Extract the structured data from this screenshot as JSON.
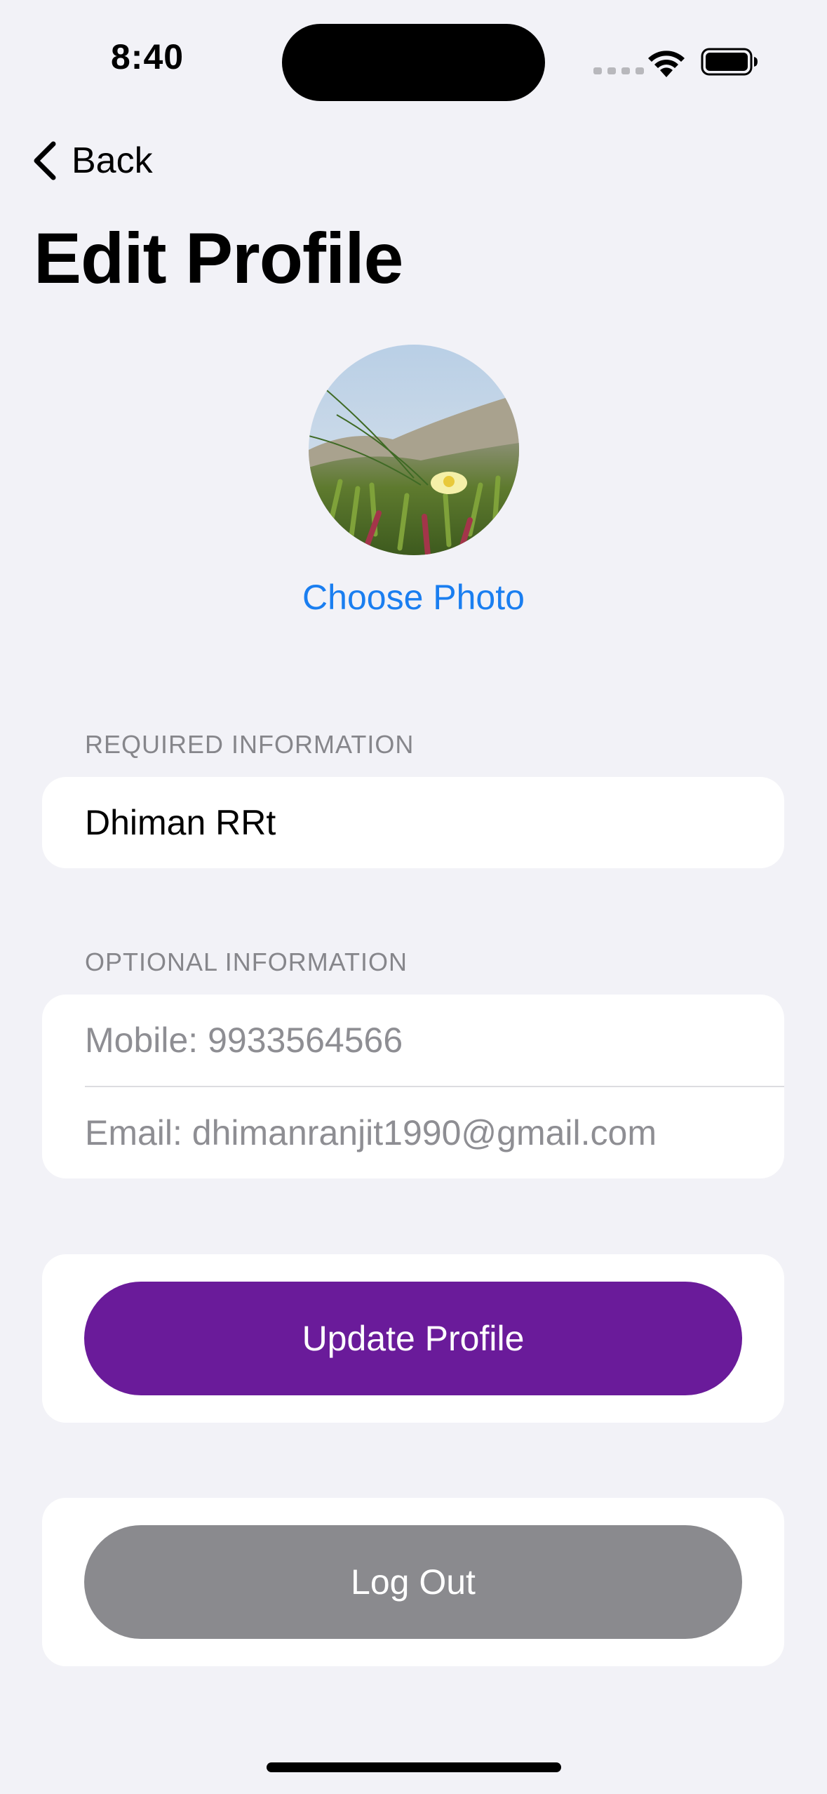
{
  "status_bar": {
    "time": "8:40",
    "icons": [
      "cellular-signal-icon",
      "wifi-icon",
      "battery-icon"
    ]
  },
  "nav": {
    "back_label": "Back",
    "title": "Edit Profile"
  },
  "avatar": {
    "choose_photo_label": "Choose Photo"
  },
  "required_section": {
    "header": "REQUIRED INFORMATION",
    "name_value": "Dhiman RRt"
  },
  "optional_section": {
    "header": "OPTIONAL INFORMATION",
    "mobile_placeholder": "Mobile: 9933564566",
    "email_placeholder": "Email: dhimanranjit1990@gmail.com"
  },
  "actions": {
    "update_label": "Update Profile",
    "logout_label": "Log Out"
  },
  "colors": {
    "background": "#F2F2F7",
    "accent_link": "#1A7EF0",
    "update_button": "#6A1B9A",
    "logout_button": "#8A8A8E"
  }
}
